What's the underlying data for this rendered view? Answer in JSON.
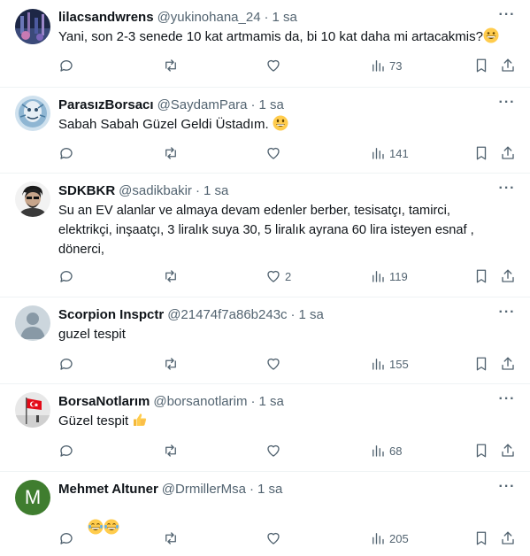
{
  "tweets": [
    {
      "name": "lilacsandwrens",
      "handle": "@yukinohana_24",
      "sep": "·",
      "time": "1 sa",
      "text": "Yani, son 2-3 senede 10 kat artmamis da, bi 10 kat daha mi artacakmis?",
      "emoji": "grinning",
      "likes": "",
      "views": "73"
    },
    {
      "name": "ParasızBorsacı",
      "handle": "@SaydamPara",
      "sep": "·",
      "time": "1 sa",
      "text": "Sabah Sabah Güzel Geldi Üstadım.",
      "emoji": "smiley",
      "likes": "",
      "views": "141"
    },
    {
      "name": "SDKBKR",
      "handle": "@sadikbakir",
      "sep": "·",
      "time": "1 sa",
      "text": "Su an EV alanlar ve almaya devam edenler berber, tesisatçı, tamirci,\nelektrikçi, inşaatçı, 3 liralık suya 30, 5 liralık ayrana 60 lira isteyen esnaf ,\ndönerci,",
      "emoji": "",
      "likes": "2",
      "views": "119"
    },
    {
      "name": "Scorpion Inspctr",
      "handle": "@21474f7a86b243c",
      "sep": "·",
      "time": "1 sa",
      "text": "guzel tespit",
      "emoji": "",
      "likes": "",
      "views": "155"
    },
    {
      "name": "BorsaNotlarım",
      "handle": "@borsanotlarim",
      "sep": "·",
      "time": "1 sa",
      "text": "Güzel tespit",
      "emoji": "thumbs-up",
      "likes": "",
      "views": "68"
    },
    {
      "name": "Mehmet Altuner",
      "handle": "@DrmillerMsa",
      "sep": "·",
      "time": "1 sa",
      "text": "",
      "emoji": "joy-joy",
      "likes": "",
      "views": "205"
    }
  ],
  "avatar_initial_6": "M",
  "more_label": "···",
  "colors": {
    "text": "#0f1419",
    "secondary": "#536471",
    "divider": "#eff3f4",
    "avatar_green": "#3f7d2f"
  }
}
